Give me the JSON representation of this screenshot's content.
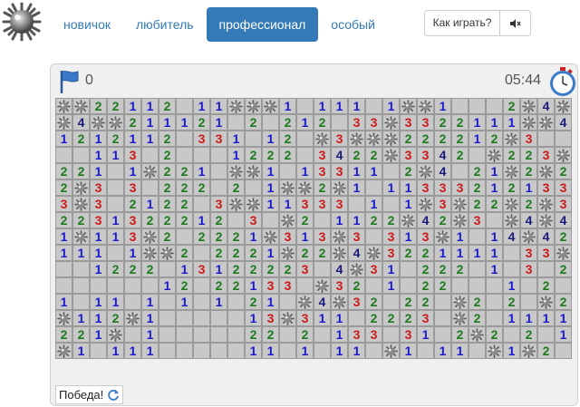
{
  "nav": {
    "items": [
      {
        "id": "novice",
        "label": "новичок",
        "active": false
      },
      {
        "id": "amateur",
        "label": "любитель",
        "active": false
      },
      {
        "id": "pro",
        "label": "профессионал",
        "active": true
      },
      {
        "id": "special",
        "label": "особый",
        "active": false
      }
    ],
    "help_label": "Как играть?"
  },
  "game": {
    "flags_remaining": "0",
    "timer": "05:44",
    "status": "Победа!"
  },
  "colors": {
    "accent": "#337ab7",
    "n1": "#1a1acc",
    "n2": "#1e7a1e",
    "n3": "#cc1a1a",
    "n4": "#1a1a7a",
    "n5": "#7a1a1a",
    "cell_bg": "#c8c8c8",
    "cell_border": "#9a9a9a"
  },
  "board": {
    "rows": 16,
    "cols": 30,
    "cells": [
      "**22112 11***1 111 1**1   2*4*2",
      "*4**211121 2 212 33*3322111**42",
      "1212112 331 12 *3***222212*3 ",
      "  113 2   1222 3422*3342 *223*2",
      "221 1*221 **1 13311 2*4 21*2*22",
      "2*3 3 222 2 1**2*1 113332121333",
      "3*3 2122 3**11333 1 1*3*22*2*31",
      "2231322212 3 *2 1122*42*3 *4*42",
      "1*113*2 2221*313*3 313*1 14*42",
      "111 1**2 2221*22*4*3221111 33*1",
      "  1222 13122223 4*31 222 1 3 2",
      "      12 22133 *32 1 22   1 2 1",
      "1 11 1 1 1 21 *4*32 22 *2 2 *2 ",
      "*112*1     13*311 2223 *2 1111",
      "221* 1     22 2 133 31 2*2 2 1*",
      "*1 111     11 1 11 *1 11 *1*2 1"
    ]
  }
}
